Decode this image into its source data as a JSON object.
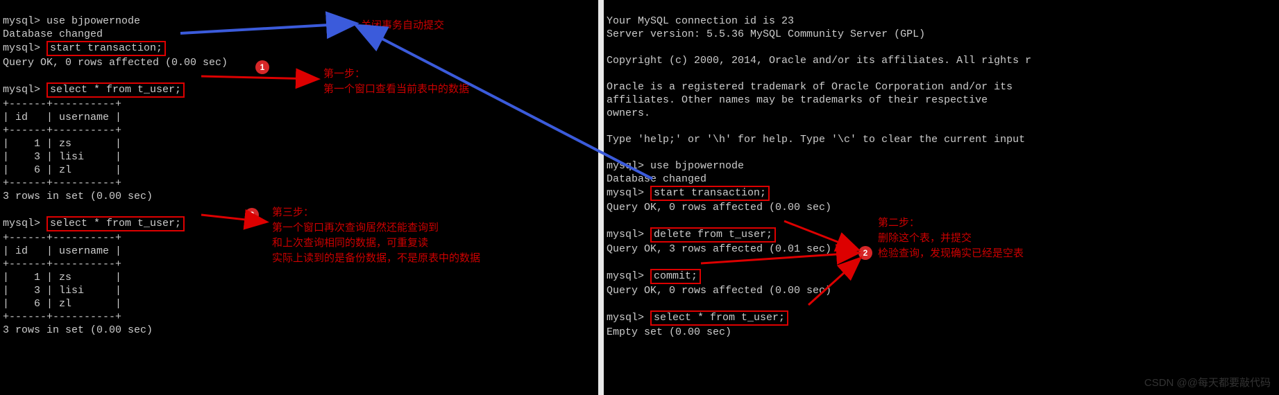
{
  "left": {
    "line1": "mysql> use bjpowernode",
    "line2": "Database changed",
    "prompt": "mysql> ",
    "cmd_start_tx": "start transaction;",
    "qok0": "Query OK, 0 rows affected (0.00 sec)",
    "cmd_select1": "select * from t_user;",
    "table": {
      "border": "+------+----------+",
      "header": "| id   | username |",
      "rows": [
        "|    1 | zs       |",
        "|    3 | lisi     |",
        "|    6 | zl       |"
      ],
      "footer": "3 rows in set (0.00 sec)"
    },
    "cmd_select2": "select * from t_user;"
  },
  "right": {
    "line1": "Your MySQL connection id is 23",
    "line2": "Server version: 5.5.36 MySQL Community Server (GPL)",
    "copyright": "Copyright (c) 2000, 2014, Oracle and/or its affiliates. All rights r",
    "trademark1": "Oracle is a registered trademark of Oracle Corporation and/or its",
    "trademark2": "affiliates. Other names may be trademarks of their respective",
    "trademark3": "owners.",
    "help": "Type 'help;' or '\\h' for help. Type '\\c' to clear the current input ",
    "use": "mysql> use bjpowernode",
    "dbchanged": "Database changed",
    "prompt": "mysql> ",
    "cmd_start_tx": "start transaction;",
    "qok0": "Query OK, 0 rows affected (0.00 sec)",
    "cmd_delete": "delete from t_user;",
    "qok3": "Query OK, 3 rows affected (0.01 sec)",
    "cmd_commit": "commit;",
    "qok0b": "Query OK, 0 rows affected (0.00 sec)",
    "cmd_select": "select * from t_user;",
    "empty": "Empty set (0.00 sec)"
  },
  "annotations": {
    "close_auto": "关闭事务自动提交",
    "step1_title": "第一步：",
    "step1_body": "第一个窗口查看当前表中的数据",
    "step3_title": "第三步：",
    "step3_l1": "第一个窗口再次查询居然还能查询到",
    "step3_l2": "和上次查询相同的数据，可重复读",
    "step3_l3": "实际上读到的是备份数据，不是原表中的数据",
    "step2_title": "第二步：",
    "step2_l1": "删除这个表，并提交",
    "step2_l2": "检验查询，发现确实已经是空表"
  },
  "badges": {
    "b1": "1",
    "b2": "2",
    "b3": "3"
  },
  "watermark": "CSDN @@每天都要敲代码"
}
